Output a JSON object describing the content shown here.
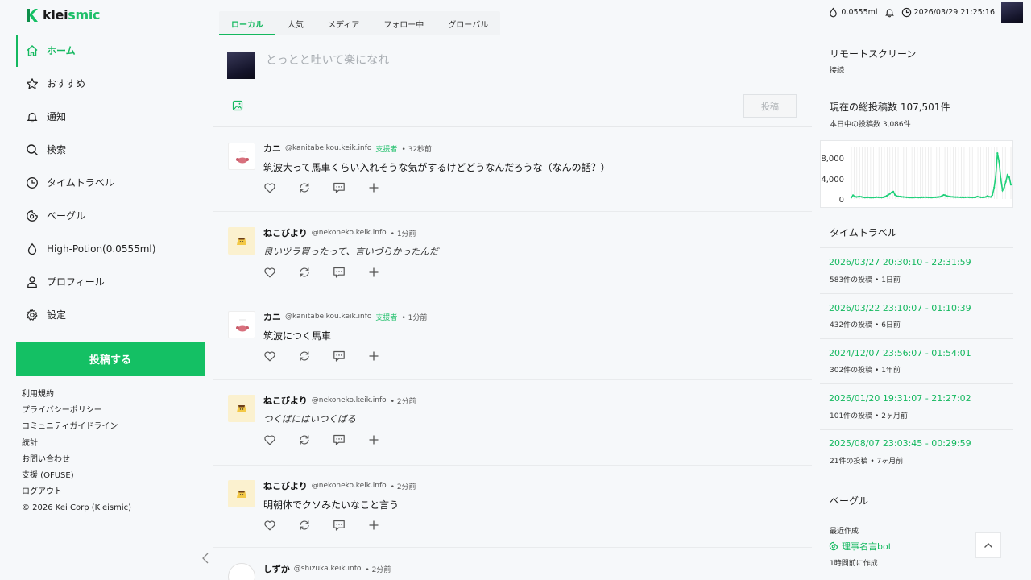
{
  "brand": {
    "name_prefix": "klei",
    "name_suffix": "smic"
  },
  "nav": {
    "items": [
      {
        "label": "ホーム",
        "icon": "home-icon"
      },
      {
        "label": "おすすめ",
        "icon": "star-icon"
      },
      {
        "label": "通知",
        "icon": "bell-icon"
      },
      {
        "label": "検索",
        "icon": "search-icon"
      },
      {
        "label": "タイムトラベル",
        "icon": "clock-icon"
      },
      {
        "label": "ベーグル",
        "icon": "bagel-icon"
      },
      {
        "label": "High-Potion(0.0555ml)",
        "icon": "drop-icon"
      },
      {
        "label": "プロフィール",
        "icon": "user-icon"
      },
      {
        "label": "設定",
        "icon": "gear-icon"
      }
    ],
    "active_index": 0,
    "post_button": "投稿する"
  },
  "footer": {
    "links": [
      "利用規約",
      "プライバシーポリシー",
      "コミュニティガイドライン",
      "統計",
      "お問い合わせ",
      "支援 (OFUSE)",
      "ログアウト"
    ],
    "copyright": "© 2026 Kei Corp (Kleismic)"
  },
  "tabs": [
    {
      "label": "ローカル",
      "active": true
    },
    {
      "label": "人気",
      "active": false
    },
    {
      "label": "メディア",
      "active": false
    },
    {
      "label": "フォロー中",
      "active": false
    },
    {
      "label": "グローバル",
      "active": false
    }
  ],
  "compose": {
    "placeholder": "とっとと吐いて楽になれ",
    "submit_label": "投稿"
  },
  "posts": [
    {
      "name": "カニ",
      "handle": "@kanitabeikou.keik.info",
      "badge": "支援者",
      "time": "• 32秒前",
      "body": "筑波大って馬車くらい入れそうな気がするけどどうなんだろうな（なんの話？）",
      "avatar": "kani",
      "italic": false
    },
    {
      "name": "ねこびより",
      "handle": "@nekoneko.keik.info",
      "badge": "",
      "time": "• 1分前",
      "body": "良いヅラ買ったって、言いづらかったんだ",
      "avatar": "neko",
      "italic": true
    },
    {
      "name": "カニ",
      "handle": "@kanitabeikou.keik.info",
      "badge": "支援者",
      "time": "• 1分前",
      "body": "筑波につく馬車",
      "avatar": "kani",
      "italic": false
    },
    {
      "name": "ねこびより",
      "handle": "@nekoneko.keik.info",
      "badge": "",
      "time": "• 2分前",
      "body": "つくばにはいつくばる",
      "avatar": "neko",
      "italic": true
    },
    {
      "name": "ねこびより",
      "handle": "@nekoneko.keik.info",
      "badge": "",
      "time": "• 2分前",
      "body": "明朝体でクソみたいなこと言う",
      "avatar": "neko",
      "italic": false
    },
    {
      "name": "しずか",
      "handle": "@shizuka.keik.info",
      "badge": "",
      "time": "• 2分前",
      "body": "",
      "avatar": "shizu",
      "italic": false
    }
  ],
  "topbar": {
    "potion": "0.0555ml",
    "datetime": "2026/03/29 21:25:16"
  },
  "remote": {
    "title": "リモートスクリーン",
    "status": "接続"
  },
  "stats": {
    "title": "現在の総投稿数 107,501件",
    "today": "本日中の投稿数 3,086件"
  },
  "chart_data": {
    "type": "line",
    "y_ticks": [
      "8,000",
      "4,000",
      "0"
    ],
    "ylim": [
      0,
      9000
    ],
    "grid": true,
    "values": [
      250,
      650,
      450,
      350,
      400,
      420,
      380,
      300,
      250,
      280,
      300,
      260,
      240,
      260,
      280,
      320,
      300,
      280,
      260,
      300,
      400,
      550,
      750,
      900,
      1150,
      1300,
      700,
      500,
      450,
      420,
      380,
      350,
      330,
      300,
      280,
      260,
      250,
      270,
      300,
      280,
      260,
      270,
      290,
      300,
      320,
      300,
      280,
      270,
      260,
      280,
      300,
      320,
      350,
      400,
      550,
      700,
      650,
      500,
      450,
      400,
      380,
      350,
      330,
      320,
      310,
      300,
      290,
      280,
      300,
      320,
      300,
      280,
      270,
      280,
      300,
      420,
      380,
      300,
      280,
      300,
      350,
      500,
      400,
      350,
      700,
      2000,
      4000,
      8000,
      6500,
      3500,
      1500,
      2000,
      3000,
      4200,
      3800,
      2500
    ],
    "color": "#1fd07a"
  },
  "time_travel": {
    "title": "タイムトラベル",
    "entries": [
      {
        "range": "2026/03/27 20:30:10 - 22:31:59",
        "meta": "583件の投稿 • 1日前"
      },
      {
        "range": "2026/03/22 23:10:07 - 01:10:39",
        "meta": "432件の投稿 • 6日前"
      },
      {
        "range": "2024/12/07 23:56:07 - 01:54:01",
        "meta": "302件の投稿 • 1年前"
      },
      {
        "range": "2026/01/20 19:31:07 - 21:27:02",
        "meta": "101件の投稿 • 2ヶ月前"
      },
      {
        "range": "2025/08/07 23:03:45 - 00:29:59",
        "meta": "21件の投稿 • 7ヶ月前"
      }
    ]
  },
  "bagel": {
    "title": "ベーグル",
    "recent_label": "最近作成",
    "bot_name": "理事名言bot",
    "created": "1時間前に作成"
  },
  "colors": {
    "accent": "#14c064",
    "link": "#14b85f"
  }
}
